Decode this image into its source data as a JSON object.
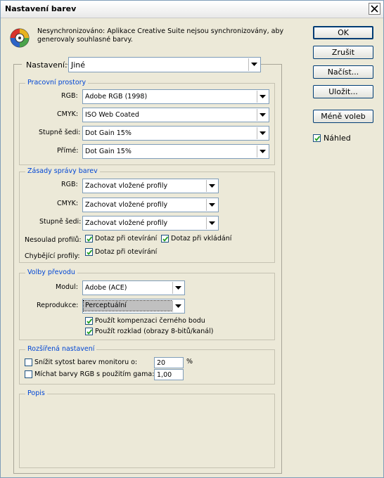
{
  "window": {
    "title": "Nastavení barev"
  },
  "warning": {
    "line1": "Nesynchronizováno: Aplikace Creative Suite nejsou synchronizovány, aby",
    "line2": "generovaly souhlasné barvy."
  },
  "buttons": {
    "ok": "OK",
    "cancel": "Zrušit",
    "load": "Načíst...",
    "save": "Uložit...",
    "fewer": "Méně voleb"
  },
  "preview": {
    "label": "Náhled",
    "checked": true
  },
  "settings": {
    "label": "Nastavení:",
    "value": "Jiné"
  },
  "working_spaces": {
    "title": "Pracovní prostory",
    "rgb": {
      "label": "RGB:",
      "value": "Adobe RGB (1998)"
    },
    "cmyk": {
      "label": "CMYK:",
      "value": "ISO Web Coated"
    },
    "gray": {
      "label": "Stupně šedi:",
      "value": "Dot Gain 15%"
    },
    "spot": {
      "label": "Přímé:",
      "value": "Dot Gain 15%"
    }
  },
  "policies": {
    "title": "Zásady správy barev",
    "rgb": {
      "label": "RGB:",
      "value": "Zachovat vložené profily"
    },
    "cmyk": {
      "label": "CMYK:",
      "value": "Zachovat vložené profily"
    },
    "gray": {
      "label": "Stupně šedi:",
      "value": "Zachovat vložené profily"
    },
    "mismatch_label": "Nesoulad profilů:",
    "mismatch_open": "Dotaz při otevírání",
    "mismatch_paste": "Dotaz při vkládání",
    "missing_label": "Chybějící profily:",
    "missing_open": "Dotaz při otevírání"
  },
  "conversion": {
    "title": "Volby převodu",
    "engine": {
      "label": "Modul:",
      "value": "Adobe (ACE)"
    },
    "intent": {
      "label": "Reprodukce:",
      "value": "Perceptuální"
    },
    "bpc": "Použít kompenzaci černého bodu",
    "dither": "Použít rozklad (obrazy 8-bitů/kanál)"
  },
  "advanced": {
    "title": "Rozšířená nastavení",
    "desaturate": {
      "label": "Snížit sytost barev monitoru o:",
      "value": "20",
      "unit": "%"
    },
    "blend": {
      "label": "Míchat barvy RGB s použitím gama:",
      "value": "1,00"
    }
  },
  "description": {
    "title": "Popis"
  }
}
